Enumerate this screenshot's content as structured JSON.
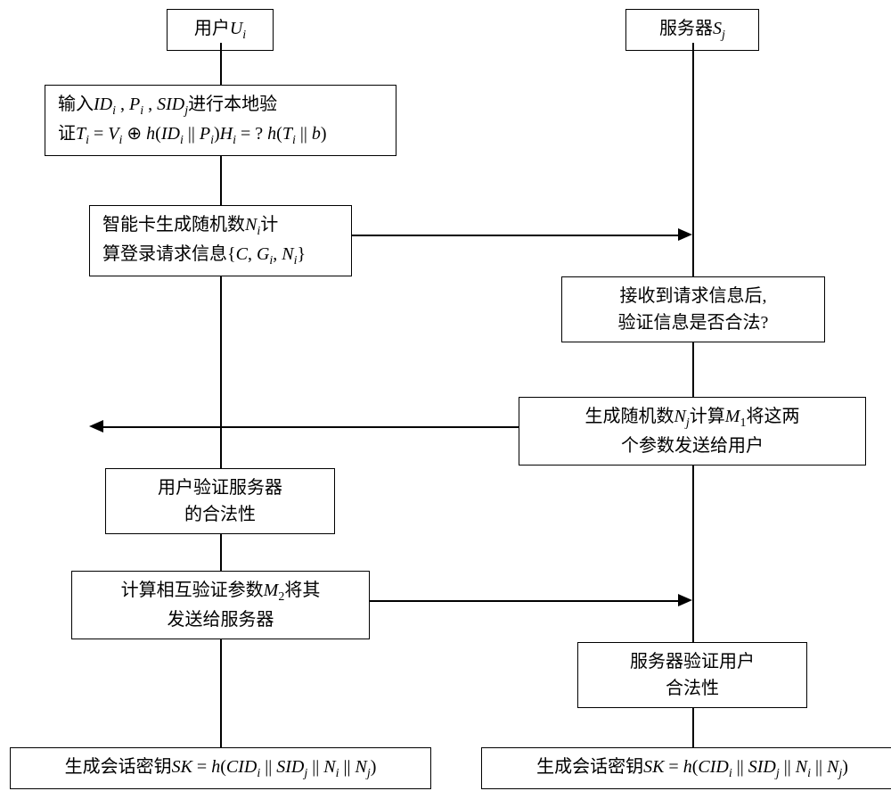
{
  "header": {
    "left": "用户Uᵢ",
    "right": "服务器Sⱼ"
  },
  "left": {
    "step1a": "输入IDᵢ , Pᵢ , SIDⱼ进行本地验",
    "step1b": "证Tᵢ = Vᵢ ⊕ h(IDᵢ || Pᵢ)Hᵢ = ? h(Tᵢ || b)",
    "step2a": "智能卡生成随机数Nᵢ计",
    "step2b": "算登录请求信息{C, Gᵢ, Nᵢ}",
    "step3a": "用户验证服务器",
    "step3b": "的合法性",
    "step4a": "计算相互验证参数M₂将其",
    "step4b": "发送给服务器",
    "finish": "生成会话密钥SK = h(CIDᵢ || SIDⱼ || Nᵢ || Nⱼ)"
  },
  "right": {
    "step1a": "接收到请求信息后,",
    "step1b": "验证信息是否合法?",
    "step2a": "生成随机数Nⱼ计算M₁将这两",
    "step2b": "个参数发送给用户",
    "step3a": "服务器验证用户",
    "step3b": "合法性",
    "finish": "生成会话密钥SK = h(CIDᵢ || SIDⱼ || Nᵢ || Nⱼ)"
  }
}
